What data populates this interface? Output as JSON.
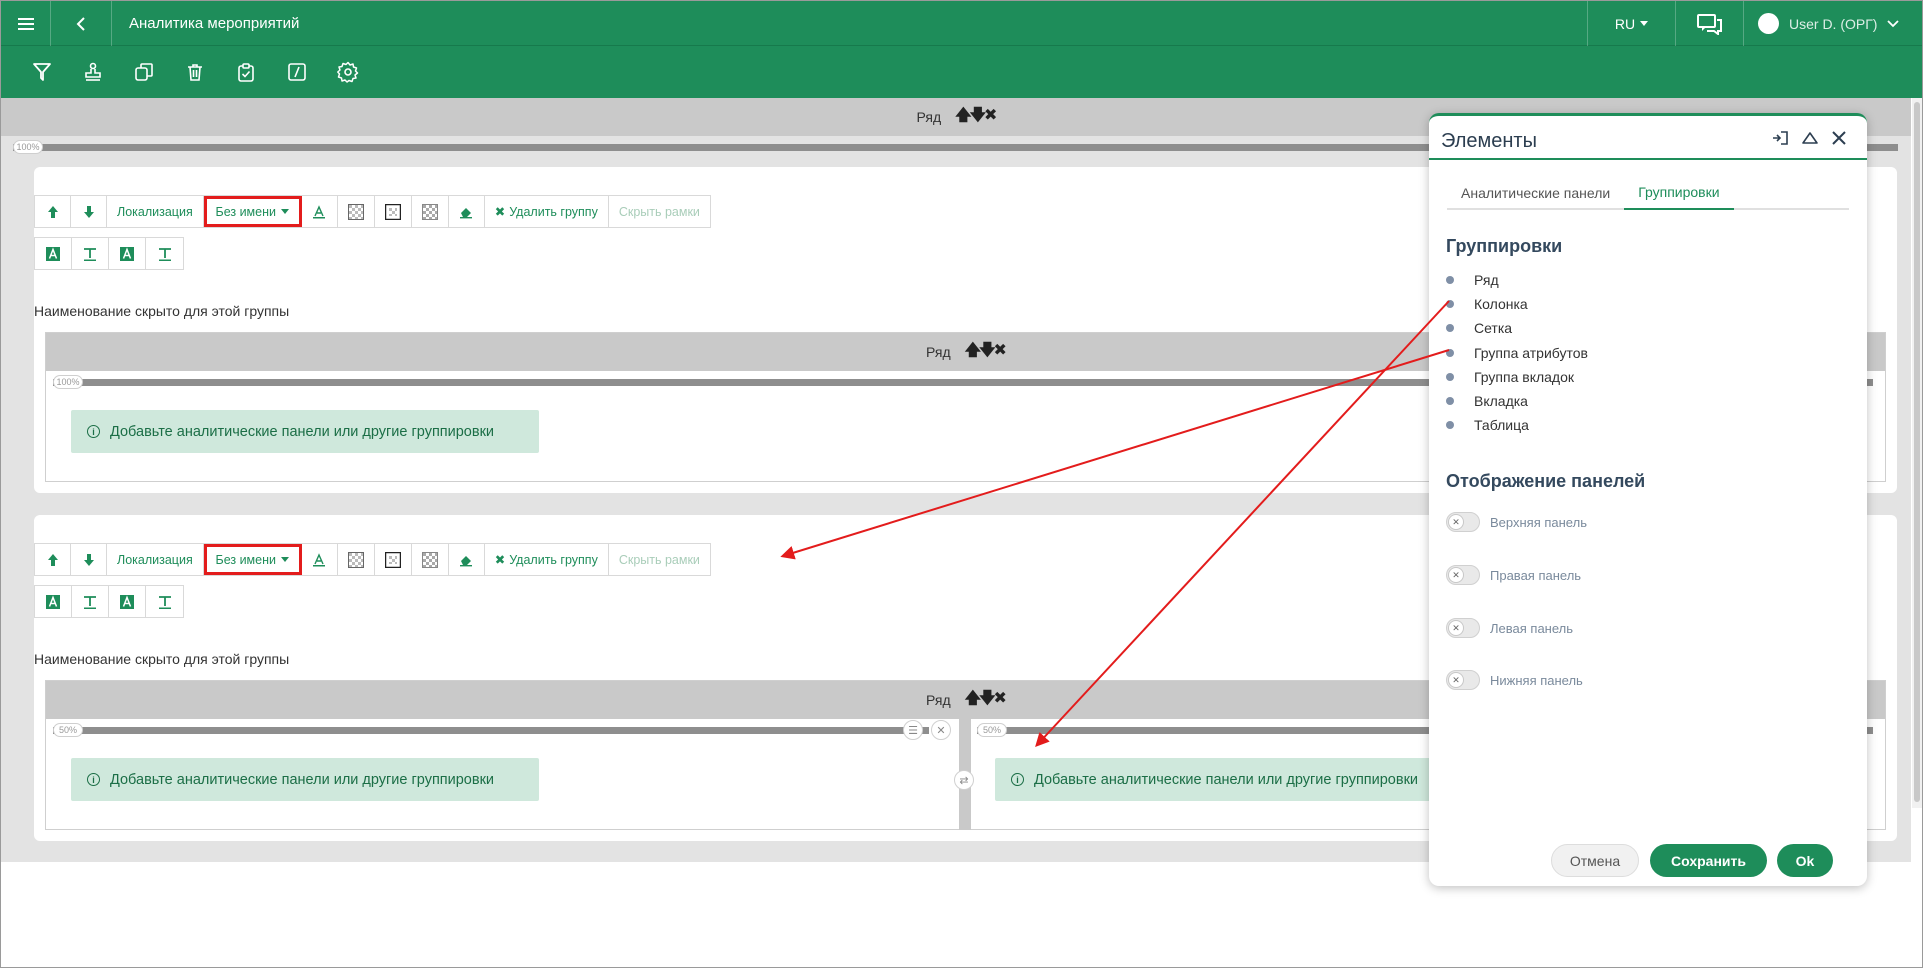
{
  "header": {
    "title": "Аналитика мероприятий",
    "lang": "RU",
    "user": "User D. (ОРГ)"
  },
  "canvas": {
    "row_label": "Ряд",
    "arrows": "🡅🡇✖",
    "pct100": "100%",
    "pct50": "50%"
  },
  "group_toolbar": {
    "localization": "Локализация",
    "name": "Без имени",
    "delete_group": "Удалить группу",
    "hide_frames": "Скрыть рамки"
  },
  "groups": {
    "hidden_name": "Наименование скрыто для этой группы",
    "hint": "Добавьте аналитические панели или другие группировки"
  },
  "panel": {
    "title": "Элементы",
    "tabs": [
      "Аналитические панели",
      "Группировки"
    ],
    "groupings_title": "Группировки",
    "groupings": [
      "Ряд",
      "Колонка",
      "Сетка",
      "Группа атрибутов",
      "Группа вкладок",
      "Вкладка",
      "Таблица"
    ],
    "display_title": "Отображение панелей",
    "toggles": [
      "Верхняя панель",
      "Правая панель",
      "Левая панель",
      "Нижняя панель"
    ],
    "cancel": "Отмена",
    "save": "Сохранить",
    "ok": "Ok"
  },
  "colors": {
    "brand": "#1e8d5a",
    "annotation": "#e31c1c"
  }
}
